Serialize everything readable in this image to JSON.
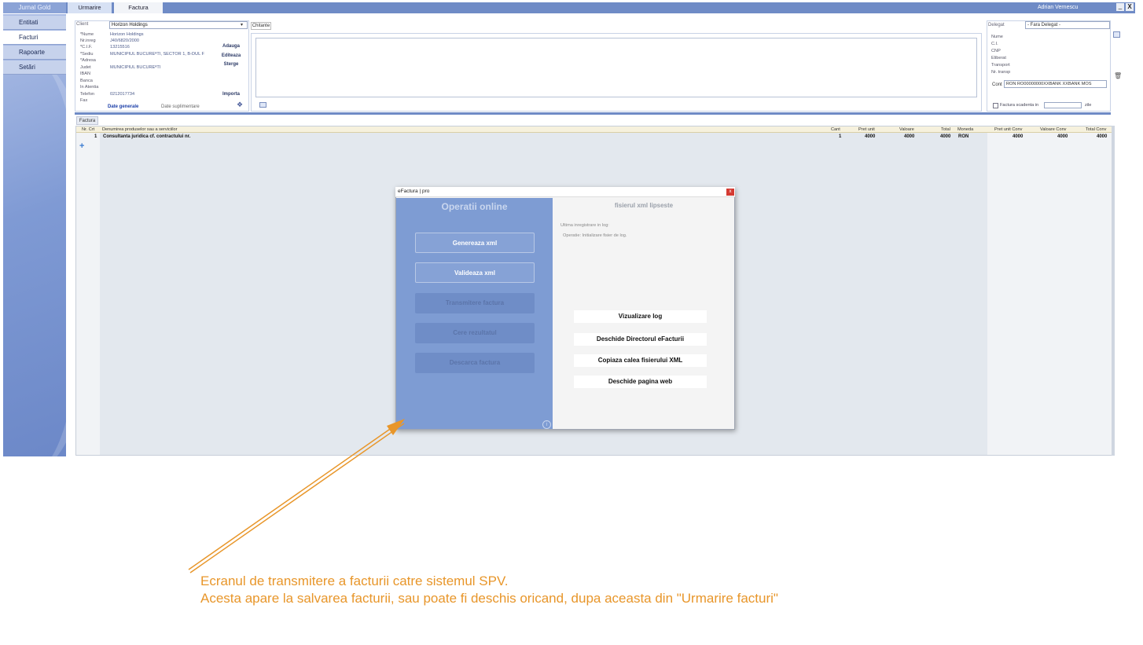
{
  "app": {
    "title": "Jurnal Gold",
    "tabs": [
      "Urmarire",
      "Factura"
    ],
    "user": "Adrian Vernescu",
    "minimize": "_",
    "close": "X"
  },
  "sidebar": {
    "items": [
      {
        "label": "Entitati"
      },
      {
        "label": "Facturi"
      },
      {
        "label": "Rapoarte"
      },
      {
        "label": "Setări"
      }
    ]
  },
  "client": {
    "label": "Client",
    "selected": "Horizon Holdings",
    "fields": [
      {
        "label": "*Nume",
        "value": "Horizon Holdings"
      },
      {
        "label": "Nr.inreg",
        "value": "J40/6820/2000"
      },
      {
        "label": "*C.I.F.",
        "value": "13215516"
      },
      {
        "label": "*Sediu",
        "value": "MUNICIPIUL BUCUREªTI, SECTOR 1, B-DUL F"
      },
      {
        "label": "*Adresa",
        "value": ""
      },
      {
        "label": "Judet",
        "value": "MUNICIPIUL BUCUREªTI"
      },
      {
        "label": "IBAN",
        "value": ""
      },
      {
        "label": "Banca",
        "value": ""
      },
      {
        "label": "In Atentia",
        "value": ""
      },
      {
        "label": "Telefon",
        "value": "0212017734"
      },
      {
        "label": "Fax",
        "value": ""
      }
    ],
    "actions": {
      "add": "Adauga",
      "edit": "Editeaza",
      "delete": "Sterge",
      "import": "Importa"
    },
    "tabs": {
      "general": "Date generale",
      "extra": "Date suplimentare"
    }
  },
  "chitante": {
    "label": "Chitante"
  },
  "delegat": {
    "label": "Delegat",
    "selected": "- Fara Delegat -",
    "fields": [
      "Nume",
      "C.I.",
      "CNP",
      "Eliberat",
      "Transport",
      "Nr. transp"
    ],
    "cont_label": "Cont",
    "cont_value": "RON  RO00000000XXBANK  XXBANK MOS",
    "scadenta_label": "Factura scadenta in",
    "scadenta_unit": "zile"
  },
  "grid": {
    "tab": "Factura",
    "columns": [
      "Nr. Crt",
      "Denumirea produselor sau a serviciilor",
      "Cant",
      "Pret unit",
      "Valoare",
      "Total",
      "Moneda",
      "Pret unit Conv",
      "Valoare Conv",
      "Total Conv"
    ],
    "rows": [
      {
        "nr": "1",
        "name": "Consultanta juridica cf. contractului nr.",
        "cant": "1",
        "pret": "4000",
        "valoare": "4000",
        "total": "4000",
        "moneda": "RON",
        "pret_conv": "4000",
        "valoare_conv": "4000",
        "total_conv": "4000"
      }
    ],
    "add_icon": "+"
  },
  "modal": {
    "title": "eFactura | pro",
    "close": "x",
    "left_title": "Operatii online",
    "buttons": [
      {
        "label": "Genereaza xml",
        "enabled": true
      },
      {
        "label": "Valideaza xml",
        "enabled": true
      },
      {
        "label": "Transmitere factura",
        "enabled": false
      },
      {
        "label": "Cere rezultatul",
        "enabled": false
      },
      {
        "label": "Descarca factura",
        "enabled": false
      }
    ],
    "info": "i",
    "right_title": "fisierul xml lipseste",
    "last_log_label": "Ultima inregistrare in log:",
    "last_log_op": "Operatie: Initializare fisier de log.",
    "right_buttons": [
      "Vizualizare log",
      "Deschide Directorul eFacturii",
      "Copiaza calea fisierului XML",
      "Deschide pagina web"
    ]
  },
  "annotation": {
    "line1": "Ecranul de transmitere a facturii catre sistemul SPV.",
    "line2": "Acesta apare la salvarea facturii, sau poate fi deschis oricand, dupa aceasta din \"Urmarire facturi\"",
    "color": "#e8962a"
  }
}
